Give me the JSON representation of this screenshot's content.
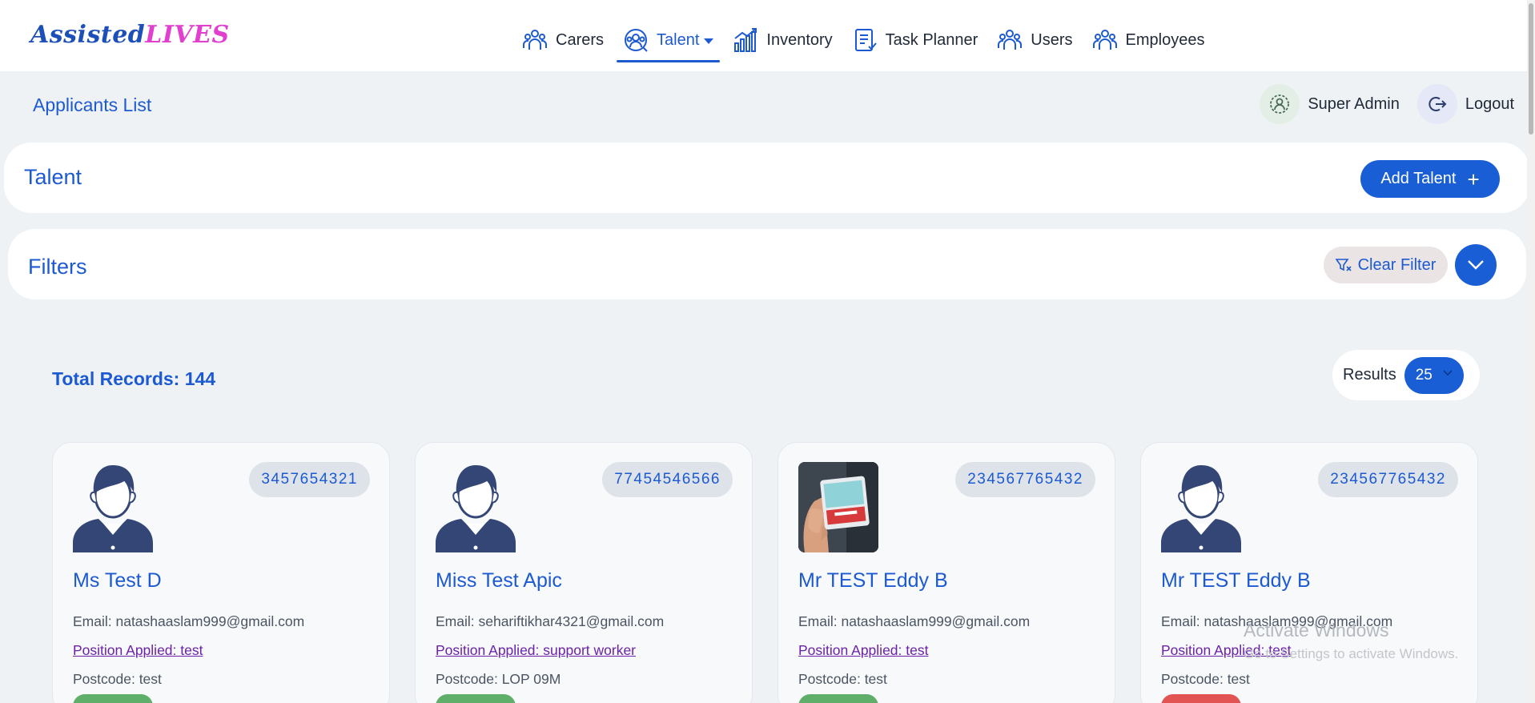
{
  "logo": {
    "part1": "Assisted",
    "part2": "LIVES"
  },
  "nav": [
    {
      "label": "Carers",
      "icon": "group-icon",
      "active": false
    },
    {
      "label": "Talent",
      "icon": "talent-icon",
      "active": true
    },
    {
      "label": "Inventory",
      "icon": "chart-icon",
      "active": false
    },
    {
      "label": "Task Planner",
      "icon": "clipboard-icon",
      "active": false
    },
    {
      "label": "Users",
      "icon": "group-icon",
      "active": false
    },
    {
      "label": "Employees",
      "icon": "group-icon",
      "active": false
    }
  ],
  "breadcrumb": "Applicants List",
  "user": {
    "name": "Super Admin",
    "logout": "Logout"
  },
  "talent_panel": {
    "title": "Talent",
    "add_button": "Add Talent",
    "add_icon": "+"
  },
  "filters_panel": {
    "title": "Filters",
    "clear_button": "Clear Filter"
  },
  "total_records": "Total Records: 144",
  "results": {
    "label": "Results",
    "value": "25"
  },
  "applicants": [
    {
      "id": "3457654321",
      "name": "Ms Test D",
      "email": "Email: natashaaslam999@gmail.com",
      "position": "Position Applied: test",
      "postcode": "Postcode: test",
      "photo": "default-avatar",
      "status_color": "#5fae6a"
    },
    {
      "id": "77454546566",
      "name": "Miss Test Apic",
      "email": "Email: sehariftikhar4321@gmail.com",
      "position": "Position Applied: support worker",
      "postcode": "Postcode: LOP 09M",
      "photo": "default-avatar",
      "status_color": "#5fae6a"
    },
    {
      "id": "234567765432",
      "name": "Mr TEST Eddy B",
      "email": "Email: natashaaslam999@gmail.com",
      "position": "Position Applied: test",
      "postcode": "Postcode: test",
      "photo": "id-card-photo",
      "status_color": "#5fae6a"
    },
    {
      "id": "234567765432",
      "name": "Mr TEST Eddy B",
      "email": "Email: natashaaslam999@gmail.com",
      "position": "Position Applied: test",
      "postcode": "Postcode: test",
      "photo": "default-avatar",
      "status_color": "#e25454"
    }
  ],
  "watermark": {
    "title": "Activate Windows",
    "subtitle": "Go to Settings to activate Windows."
  },
  "colors": {
    "primary": "#1a5ed6",
    "accent_pink": "#e23fcf",
    "background": "#eef2f4"
  }
}
